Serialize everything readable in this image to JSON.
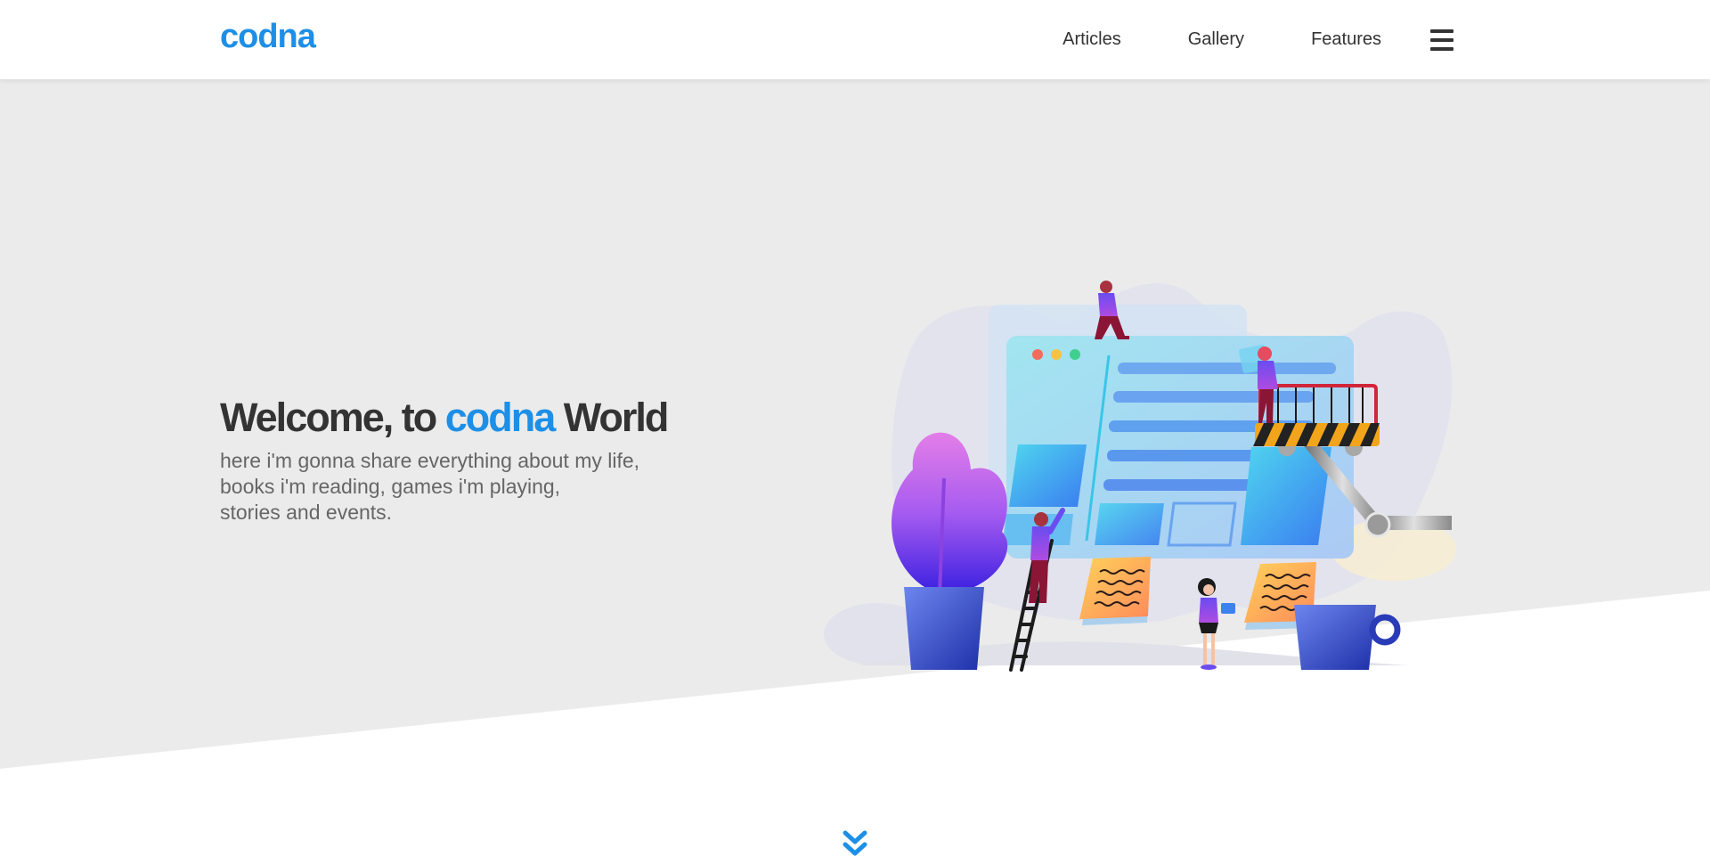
{
  "header": {
    "logo": "codna",
    "nav": [
      {
        "label": "Articles"
      },
      {
        "label": "Gallery"
      },
      {
        "label": "Features"
      }
    ],
    "menu_icon": "hamburger-menu-icon"
  },
  "hero": {
    "title_prefix": "Welcome, to ",
    "title_brand": "codna",
    "title_suffix": " World",
    "subtitle_lines": [
      "here i'm gonna share everything about my life,",
      "books i'm reading, games i'm playing,",
      "stories and events."
    ],
    "illustration": "team-building-website-illustration",
    "scroll_icon": "double-chevron-down-icon"
  },
  "colors": {
    "brand": "#1e8fe6",
    "text_dark": "#333333",
    "text_muted": "#666666",
    "hero_bg": "#ebebeb"
  }
}
